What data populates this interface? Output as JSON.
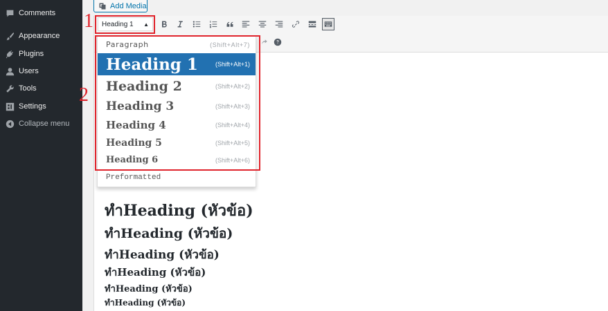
{
  "sidebar": {
    "items": [
      {
        "label": "Comments",
        "icon": "comment-icon"
      },
      {
        "label": "Appearance",
        "icon": "paintbrush-icon"
      },
      {
        "label": "Plugins",
        "icon": "plug-icon"
      },
      {
        "label": "Users",
        "icon": "user-icon"
      },
      {
        "label": "Tools",
        "icon": "wrench-icon"
      },
      {
        "label": "Settings",
        "icon": "settings-icon"
      },
      {
        "label": "Collapse menu",
        "icon": "collapse-icon"
      }
    ]
  },
  "media": {
    "add_label": "Add Media"
  },
  "toolbar": {
    "format_value": "Heading 1",
    "format_arrow": "▲"
  },
  "callouts": {
    "first": "1",
    "second": "2"
  },
  "dropdown": {
    "items": [
      {
        "label": "Paragraph",
        "shortcut": "(Shift+Alt+7)"
      },
      {
        "label": "Heading 1",
        "shortcut": "(Shift+Alt+1)"
      },
      {
        "label": "Heading 2",
        "shortcut": "(Shift+Alt+2)"
      },
      {
        "label": "Heading 3",
        "shortcut": "(Shift+Alt+3)"
      },
      {
        "label": "Heading 4",
        "shortcut": "(Shift+Alt+4)"
      },
      {
        "label": "Heading 5",
        "shortcut": "(Shift+Alt+5)"
      },
      {
        "label": "Heading 6",
        "shortcut": "(Shift+Alt+6)"
      },
      {
        "label": "Preformatted",
        "shortcut": ""
      }
    ]
  },
  "content": {
    "headings": [
      "ทำHeading (หัวข้อ)",
      "ทำHeading (หัวข้อ)",
      "ทำHeading (หัวข้อ)",
      "ทำHeading (หัวข้อ)",
      "ทำHeading (หัวข้อ)",
      "ทำHeading (หัวข้อ)"
    ]
  },
  "colors": {
    "accent": "#2271b1",
    "callout": "#e0232b",
    "sidebar": "#23282d"
  }
}
